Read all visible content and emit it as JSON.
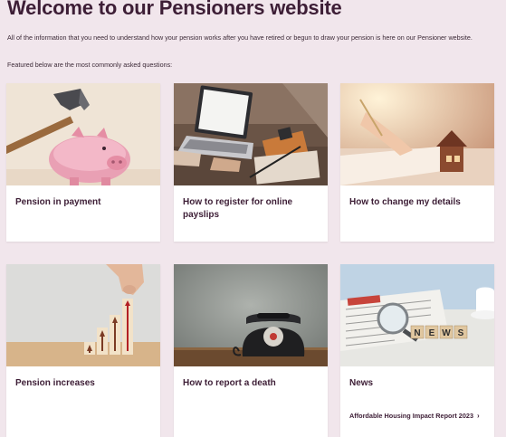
{
  "page": {
    "title": "Welcome to our Pensioners website",
    "intro": "All of the information that you need to understand how your pension works after you have retired or begun to draw your pension is here on our Pensioner website.",
    "featured": "Featured below are the most commonly asked questions:"
  },
  "cards": [
    {
      "label": "Pension in payment",
      "image": "hammer-piggy-bank-image"
    },
    {
      "label": "How to register for online payslips",
      "image": "laptop-desk-image"
    },
    {
      "label": "How to change my details",
      "image": "writing-house-image"
    },
    {
      "label": "Pension increases",
      "image": "rising-arrows-image"
    },
    {
      "label": "How to report a death",
      "image": "rotary-telephone-image"
    },
    {
      "label": "News",
      "image": "newspaper-magnifier-image",
      "link": "Affordable Housing Impact Report 2023",
      "link_icon": "chevron-right-icon"
    }
  ],
  "colors": {
    "page_background": "#f1e6ec",
    "heading_text": "#3d1e36",
    "card_background": "#ffffff"
  }
}
